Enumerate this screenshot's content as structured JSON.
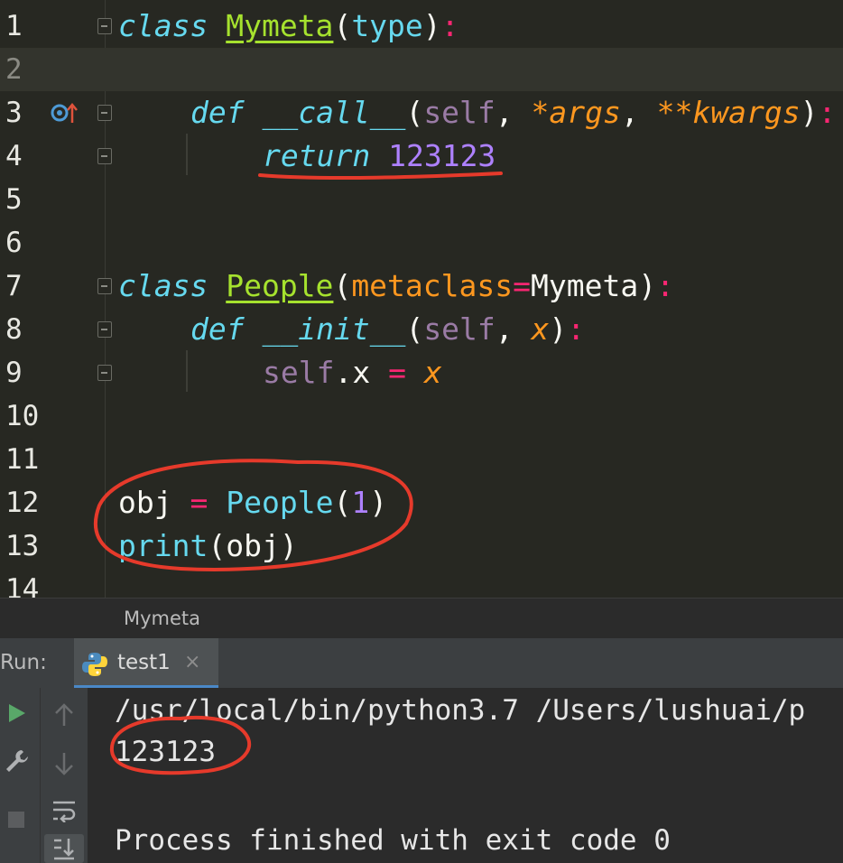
{
  "editor": {
    "lines": [
      {
        "num": "1"
      },
      {
        "num": "2"
      },
      {
        "num": "3"
      },
      {
        "num": "4"
      },
      {
        "num": "5"
      },
      {
        "num": "6"
      },
      {
        "num": "7"
      },
      {
        "num": "8"
      },
      {
        "num": "9"
      },
      {
        "num": "10"
      },
      {
        "num": "11"
      },
      {
        "num": "12"
      },
      {
        "num": "13"
      },
      {
        "num": "14"
      }
    ],
    "code": {
      "l1": {
        "kw": "class",
        "name": "Mymeta",
        "open": "(",
        "base": "type",
        "close": ")",
        "colon": ":"
      },
      "l3": {
        "kw": "def",
        "name": "__call__",
        "open": "(",
        "self": "self",
        "comma1": ", ",
        "args": "*args",
        "comma2": ", ",
        "kwargs": "**kwargs",
        "close": ")",
        "colon": ":"
      },
      "l4": {
        "kw": "return",
        "space": " ",
        "value": "123123"
      },
      "l7": {
        "kw": "class",
        "name": "People",
        "open": "(",
        "param": "metaclass",
        "eq": "=",
        "arg": "Mymeta",
        "close": ")",
        "colon": ":"
      },
      "l8": {
        "kw": "def",
        "name": "__init__",
        "open": "(",
        "self": "self",
        "comma": ", ",
        "x": "x",
        "close": ")",
        "colon": ":"
      },
      "l9": {
        "self": "self",
        "attr": ".x ",
        "eq": "=",
        "space": " ",
        "x": "x"
      },
      "l12": {
        "var": "obj ",
        "eq": "=",
        "space": " ",
        "cls": "People",
        "open": "(",
        "num": "1",
        "close": ")"
      },
      "l13": {
        "fn": "print",
        "open": "(",
        "arg": "obj",
        "close": ")"
      }
    }
  },
  "breadcrumb": {
    "label": "Mymeta"
  },
  "run": {
    "label": "Run:",
    "tab_label": "test1",
    "tab_close": "×",
    "console": [
      "/usr/local/bin/python3.7 /Users/lushuai/p",
      "123123",
      "",
      "Process finished with exit code 0"
    ]
  },
  "colors": {
    "keyword": "#66d9ef",
    "class_name": "#a6e22e",
    "self": "#9a7ba5",
    "argument": "#fd971f",
    "number": "#ae81ff",
    "operator": "#f92672",
    "annotation_red": "#e63a2b"
  }
}
